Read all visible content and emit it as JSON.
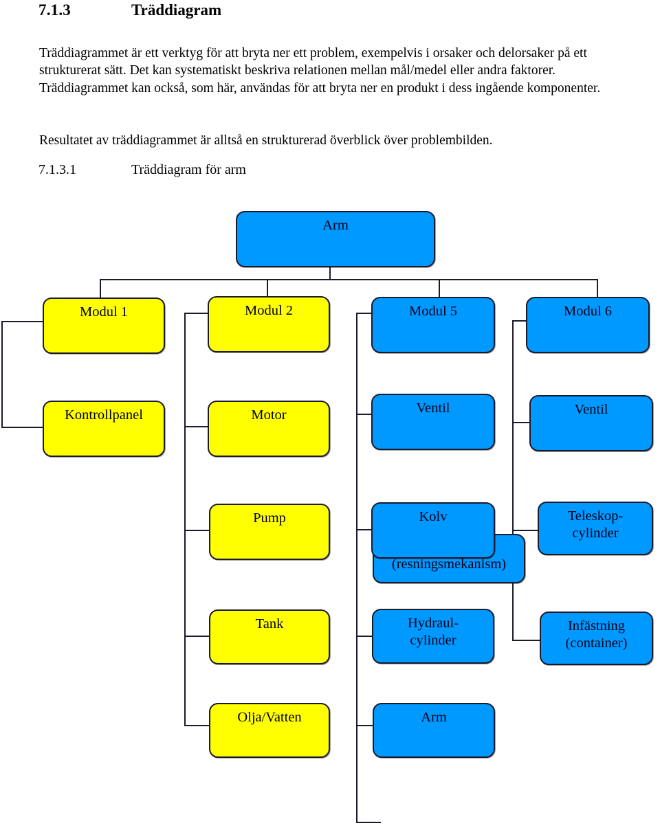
{
  "document": {
    "heading": {
      "number": "7.1.3",
      "text": "Träddiagram"
    },
    "paragraphs": [
      "Träddiagrammet är ett verktyg för att bryta ner ett problem, exempelvis i orsaker och delorsaker på ett strukturerat sätt. Det kan systematiskt beskriva relationen mellan mål/medel eller andra faktorer. Träddiagrammet kan också, som här, användas för att bryta ner en produkt i dess ingående komponenter.",
      "Resultatet av träddiagrammet är alltså en strukturerad överblick över problembilden."
    ],
    "subheading": {
      "number": "7.1.3.1",
      "text": "Träddiagram för arm"
    }
  },
  "colors": {
    "blue": "#0099ff",
    "yellow": "#ffff00",
    "outline": "#1a1a2e",
    "text": "#000018"
  },
  "diagram": {
    "type": "tree",
    "title": "Träddiagram för arm",
    "root": "Arm",
    "nodes": [
      {
        "id": "arm-root",
        "label": "Arm",
        "color": "blue",
        "col": 2,
        "row": 0
      },
      {
        "id": "modul-1",
        "label": "Modul 1",
        "color": "yellow",
        "col": 0,
        "row": 1
      },
      {
        "id": "modul-2",
        "label": "Modul 2",
        "color": "yellow",
        "col": 1,
        "row": 1
      },
      {
        "id": "modul-5",
        "label": "Modul 5",
        "color": "blue",
        "col": 2,
        "row": 1
      },
      {
        "id": "modul-6",
        "label": "Modul 6",
        "color": "blue",
        "col": 3,
        "row": 1
      },
      {
        "id": "kontrollpanel",
        "label": "Kontrollpanel",
        "color": "yellow",
        "col": 0,
        "row": 2
      },
      {
        "id": "motor",
        "label": "Motor",
        "color": "yellow",
        "col": 1,
        "row": 2
      },
      {
        "id": "ventil-1",
        "label": "Ventil",
        "color": "blue",
        "col": 2,
        "row": 2
      },
      {
        "id": "ventil-2",
        "label": "Ventil",
        "color": "blue",
        "col": 3,
        "row": 2
      },
      {
        "id": "pump",
        "label": "Pump",
        "color": "yellow",
        "col": 1,
        "row": 3
      },
      {
        "id": "resningsmekanism",
        "label": "(resningsmekanism)",
        "color": "blue",
        "col": 2,
        "row": 3
      },
      {
        "id": "kolv",
        "label": "Kolv",
        "color": "blue",
        "col": 2,
        "row": 3
      },
      {
        "id": "teleskopcylinder",
        "label": "Teleskop-\ncylinder",
        "color": "blue",
        "col": 3,
        "row": 3
      },
      {
        "id": "tank",
        "label": "Tank",
        "color": "yellow",
        "col": 1,
        "row": 4
      },
      {
        "id": "hydraulcylinder",
        "label": "Hydraul-\ncylinder",
        "color": "blue",
        "col": 2,
        "row": 4
      },
      {
        "id": "infastning",
        "label": "Infästning\n(container)",
        "color": "blue",
        "col": 3,
        "row": 4
      },
      {
        "id": "olja-vatten",
        "label": "Olja/Vatten",
        "color": "yellow",
        "col": 1,
        "row": 5
      },
      {
        "id": "arm-leaf",
        "label": "Arm",
        "color": "blue",
        "col": 2,
        "row": 5
      }
    ],
    "labels": {
      "arm_root": "Arm",
      "modul_1": "Modul 1",
      "modul_2": "Modul 2",
      "modul_5": "Modul 5",
      "modul_6": "Modul 6",
      "kontrollpanel": "Kontrollpanel",
      "motor": "Motor",
      "ventil_1": "Ventil",
      "ventil_2": "Ventil",
      "pump": "Pump",
      "resningsmekanism": "(resningsmekanism)",
      "kolv": "Kolv",
      "teleskopcylinder_l1": "Teleskop-",
      "teleskopcylinder_l2": "cylinder",
      "tank": "Tank",
      "hydraulcylinder_l1": "Hydraul-",
      "hydraulcylinder_l2": "cylinder",
      "infastning_l1": "Infästning",
      "infastning_l2": "(container)",
      "olja_vatten": "Olja/Vatten",
      "arm_leaf": "Arm"
    }
  }
}
